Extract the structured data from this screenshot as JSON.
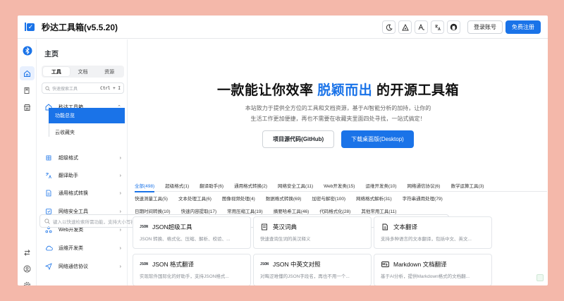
{
  "app": {
    "title": "秒达工具箱(v5.5.20)"
  },
  "header": {
    "login_label": "登录账号",
    "register_label": "免费注册"
  },
  "sidebar": {
    "title": "主页",
    "tabs": [
      "工具",
      "文档",
      "资源"
    ],
    "search_placeholder": "快速搜索工具",
    "search_shortcut": "Ctrl + I",
    "group": {
      "label": "秒达工具箱",
      "sub_items": [
        "功能总览",
        "云收藏夹"
      ]
    },
    "items": [
      "超级格式",
      "翻译助手",
      "通用格式转换",
      "网络安全工具",
      "Web开发类",
      "运维开发类",
      "网络通信协议"
    ]
  },
  "hero": {
    "title_prefix": "一款能让你效率",
    "title_highlight": "脱颖而出",
    "title_suffix": "的开源工具箱",
    "desc_line1": "本站致力于提供全方位的工具和文档资源，基于AI智能分析的加持，让你的",
    "desc_line2": "生活工作更加便捷，再也不需要在收藏夹里面四处寻找，一站式搞定！",
    "btn_source": "项目源代码(GitHub)",
    "btn_download": "下载桌面版(Desktop)"
  },
  "categories": {
    "row1": [
      "全部(498)",
      "超级格式(1)",
      "翻译助手(6)",
      "通用格式转换(2)",
      "网络安全工具(11)",
      "Web开发类(15)",
      "运维开发类(10)",
      "网络通信协议(6)",
      "数学运算工具(3)"
    ],
    "row2": [
      "快速测量工具(5)",
      "文本处理工具(6)",
      "图像视频处理(4)",
      "数据格式转换(69)",
      "加密与解密(100)",
      "网络格式解析(31)",
      "字符串通用处理(79)"
    ],
    "row3": [
      "日期时间转换(10)",
      "快速内容提取(17)",
      "常用压缩工具(19)",
      "摘要哈希工具(46)",
      "代码格式化(28)",
      "其他常用工具(11)"
    ]
  },
  "tool_search": {
    "placeholder": "键入以快速检索所需功能，支持大小写拼音"
  },
  "cards": [
    {
      "icon": "JSON",
      "title": "JSON超级工具",
      "desc": "JSON 转换、格式化、压缩、解析、校验、..."
    },
    {
      "icon": "book",
      "title": "英汉词典",
      "desc": "快速查询生词的英汉释义"
    },
    {
      "icon": "doc",
      "title": "文本翻译",
      "desc": "支持多种语言的文本翻译，包括中文、英文..."
    },
    {
      "icon": "JSON",
      "title": "JSON 格式翻译",
      "desc": "实现软件国际化的好助手，支持JSON格式..."
    },
    {
      "icon": "JSON",
      "title": "JSON 中英文对照",
      "desc": "对晦涩难懂的JSON字段名，再也不用一个..."
    },
    {
      "icon": "md",
      "title": "Markdown 文档翻译",
      "desc": "基于AI分析，提供Markdown格式的文档翻..."
    }
  ],
  "colors": {
    "accent": "#1a73e8",
    "background": "#f4b8aa"
  }
}
